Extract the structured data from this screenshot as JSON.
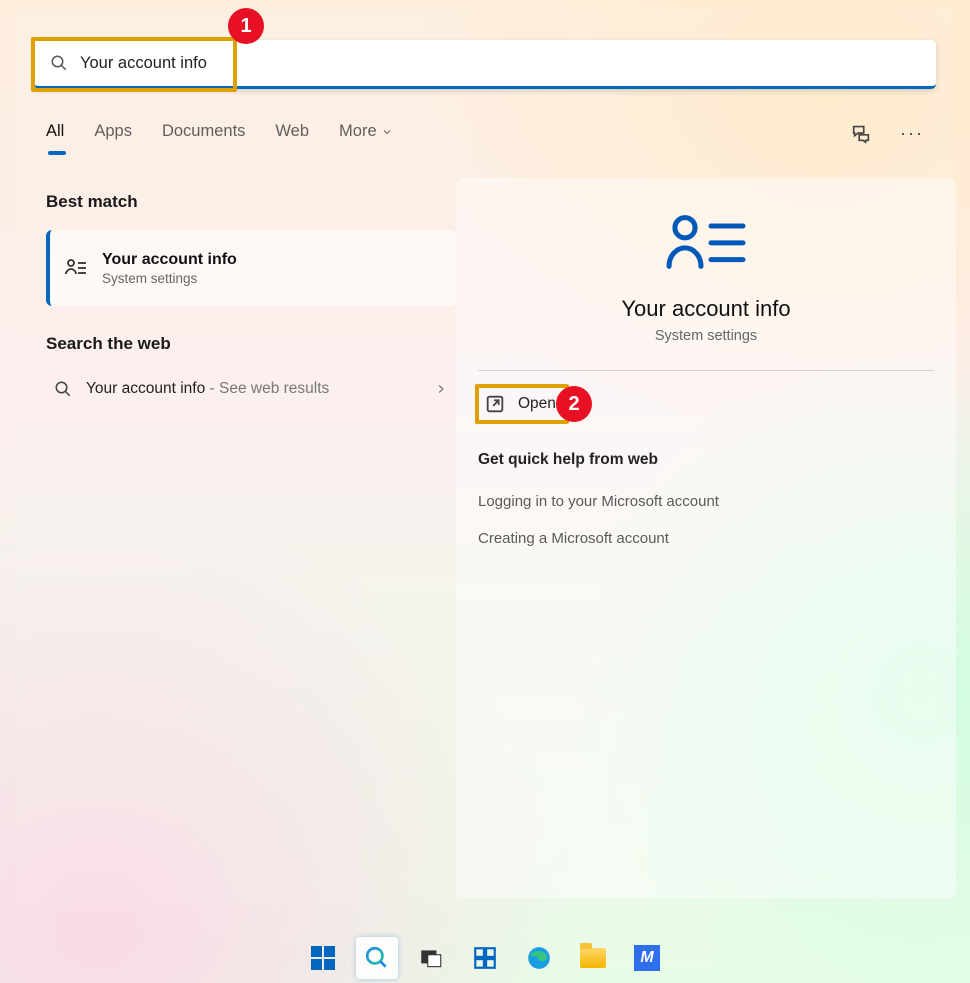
{
  "search": {
    "query": "Your account info"
  },
  "tabs": {
    "all": "All",
    "apps": "Apps",
    "documents": "Documents",
    "web": "Web",
    "more": "More"
  },
  "sections": {
    "best_match": "Best match",
    "search_web": "Search the web",
    "quick_help": "Get quick help from web"
  },
  "best": {
    "title": "Your account info",
    "subtitle": "System settings"
  },
  "web_result": {
    "title": "Your account info",
    "hint": " - See web results"
  },
  "preview": {
    "title": "Your account info",
    "subtitle": "System settings",
    "open": "Open"
  },
  "help_links": {
    "login": "Logging in to your Microsoft account",
    "create": "Creating a Microsoft account"
  },
  "annotations": {
    "one": "1",
    "two": "2"
  },
  "taskbar": {
    "app_tile_letter": "M"
  }
}
